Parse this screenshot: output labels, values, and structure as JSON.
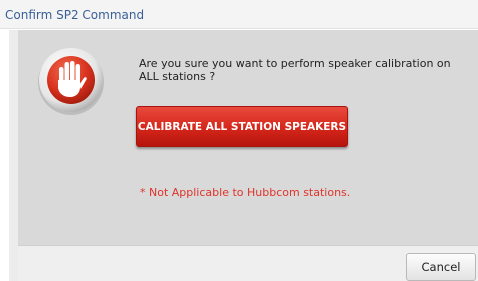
{
  "dialog": {
    "title": "Confirm SP2 Command",
    "message": "Are you sure you want to perform speaker calibration on ALL stations ?",
    "primary_button_label": "CALIBRATE ALL STATION SPEAKERS",
    "note": "* Not Applicable to Hubbcom stations.",
    "cancel_label": "Cancel",
    "icon": "stop-hand-icon"
  },
  "colors": {
    "title_text": "#3a5f97",
    "panel_background": "#d9d9d9",
    "primary_button": "#d5261b",
    "note_text": "#e0332a"
  }
}
